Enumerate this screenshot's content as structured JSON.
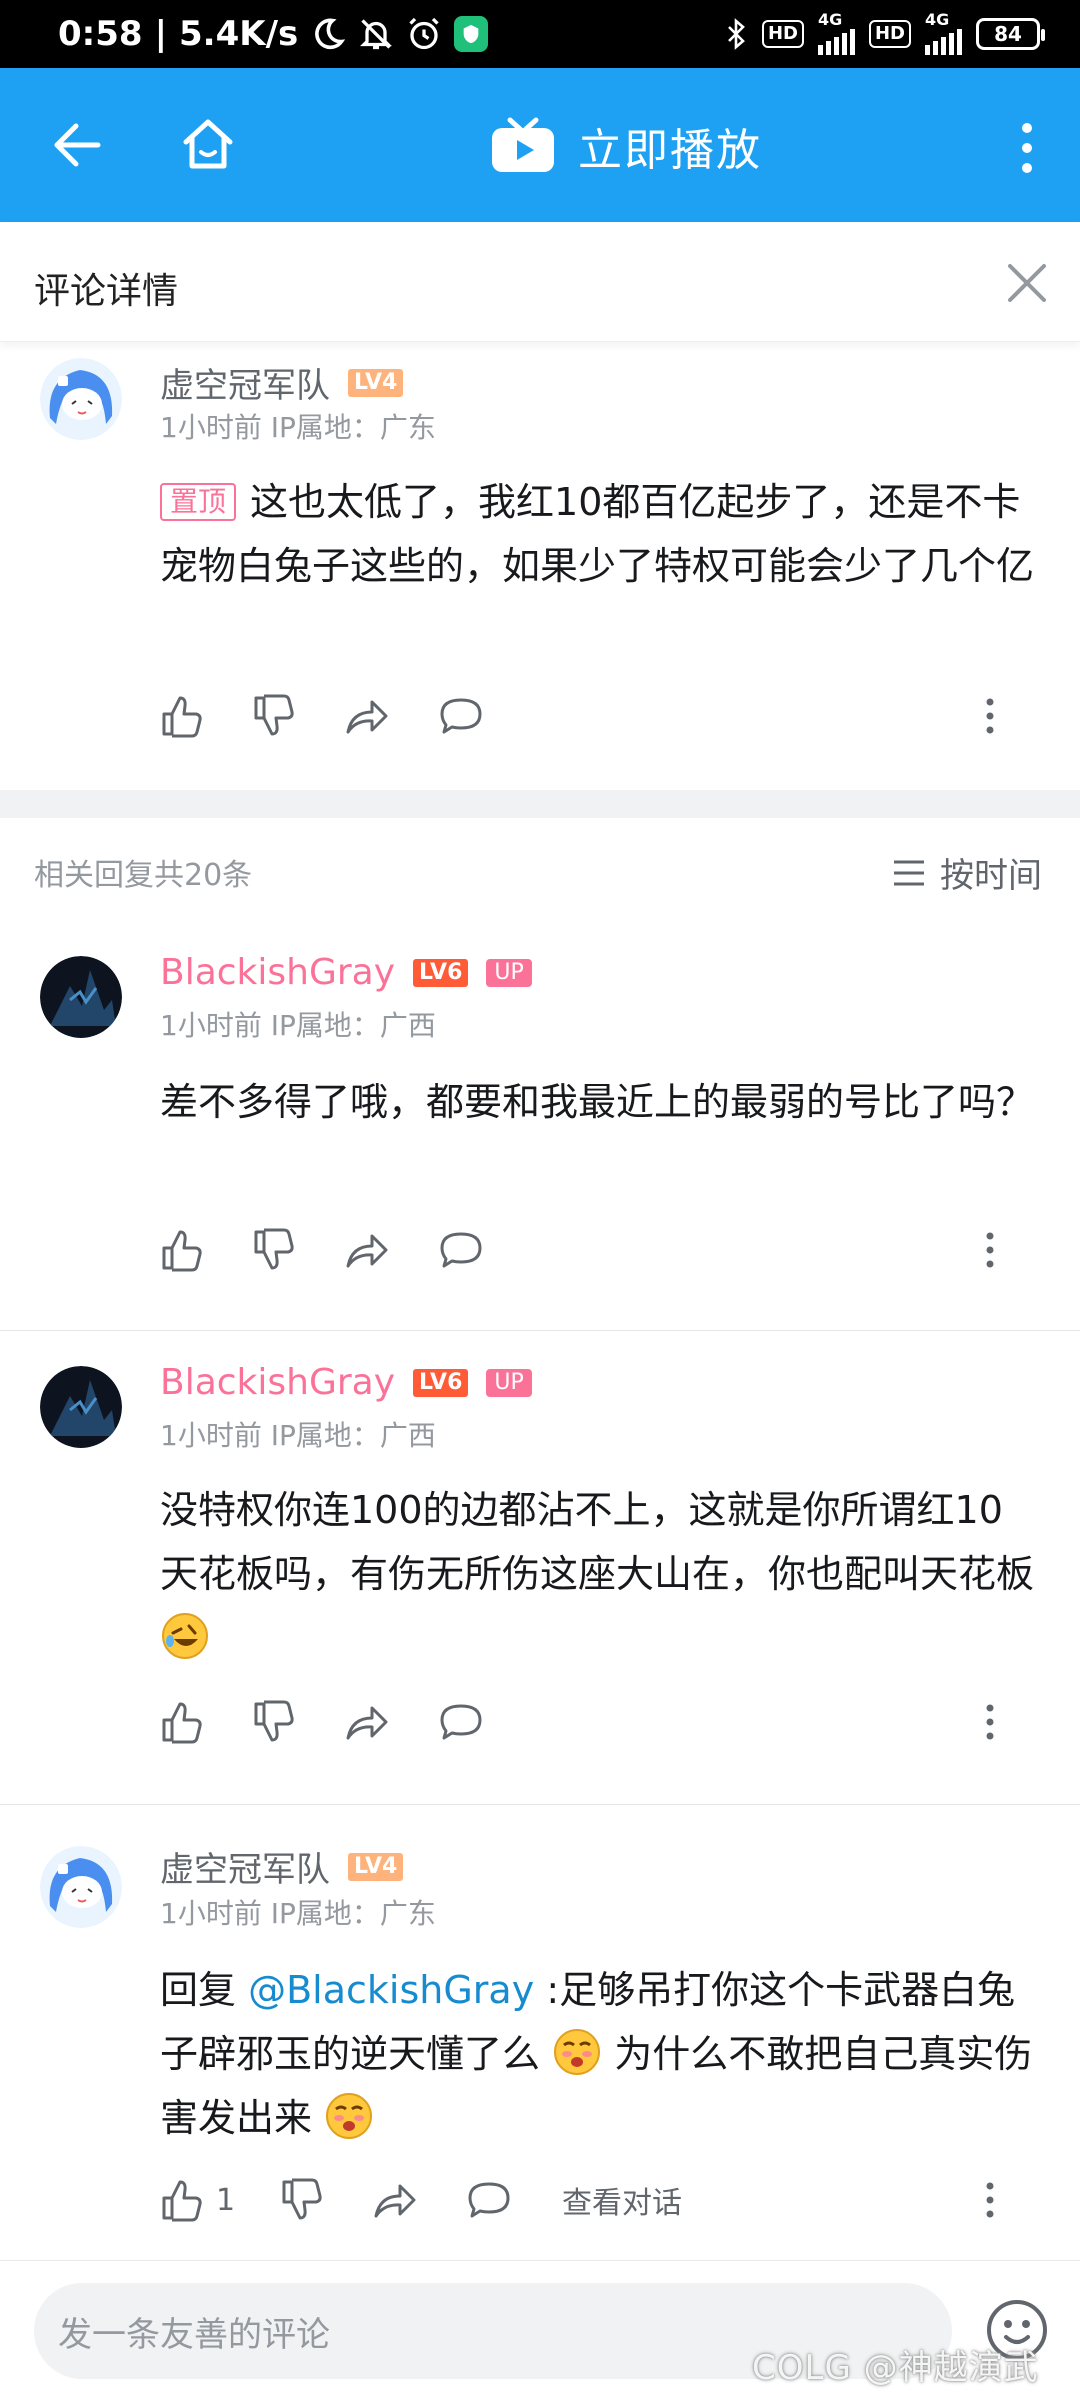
{
  "status_bar": {
    "time": "0:58",
    "speed": "5.4K/s",
    "net1": "4G",
    "net2": "4G",
    "hd": "HD",
    "battery": "84"
  },
  "appbar": {
    "play_label": "立即播放"
  },
  "detail": {
    "title": "评论详情"
  },
  "root_comment": {
    "user": "虚空冠军队",
    "level": "LV4",
    "meta": "1小时前  IP属地：广东",
    "pin": "置顶",
    "text": "这也太低了，我红10都百亿起步了，还是不卡宠物白兔子这些的，如果少了特权可能会少了几个亿"
  },
  "replies_header": {
    "count_label": "相关回复共20条",
    "sort_label": "按时间"
  },
  "replies": [
    {
      "user": "BlackishGray",
      "level": "LV6",
      "badge": "UP",
      "meta": "1小时前  IP属地：广西",
      "text": "差不多得了哦，都要和我最近上的最弱的号比了吗？"
    },
    {
      "user": "BlackishGray",
      "level": "LV6",
      "badge": "UP",
      "meta": "1小时前  IP属地：广西",
      "text": "没特权你连100的边都沾不上，这就是你所谓红10天花板吗，有伤无所伤这座大山在，你也配叫天花板"
    },
    {
      "user": "虚空冠军队",
      "level": "LV4",
      "meta": "1小时前  IP属地：广东",
      "reply_prefix": "回复",
      "mention": "@BlackishGray",
      "text_a": ":足够吊打你这个卡武器白兔子辟邪玉的逆天懂了么",
      "text_b": "为什么不敢把自己真实伤害发出来",
      "like_count": "1",
      "view_dialog": "查看对话"
    }
  ],
  "composer": {
    "placeholder": "发一条友善的评论"
  },
  "watermark": "COLG @神越演武",
  "colors": {
    "brand_blue": "#1ea1f2",
    "pink": "#fb7299",
    "mention": "#178bcf"
  }
}
